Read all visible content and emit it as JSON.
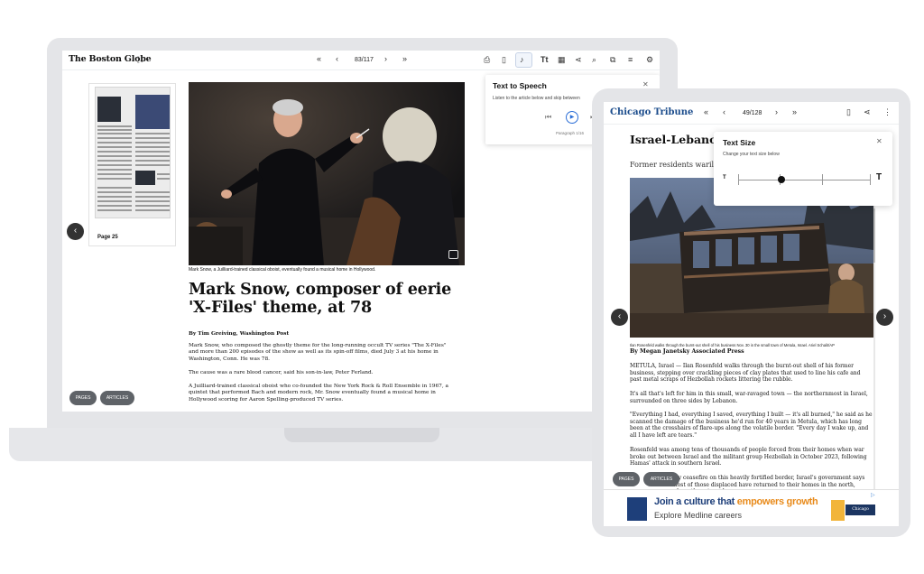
{
  "laptop": {
    "brand": "The Boston Globe",
    "page_indicator": "83/117",
    "thumbnail": {
      "label": "Page 25"
    },
    "photo_caption": "Mark Snow, a Juilliard-trained classical oboist, eventually found a musical home in Hollywood.",
    "headline": "Mark Snow, composer of eerie 'X-Files' theme, at 78",
    "byline": "By Tim Greiving, Washington Post",
    "paragraphs": [
      "Mark Snow, who composed the ghostly theme for the long-running occult TV series \"The X-Files\" and more than 200 episodes of the show as well as its spin-off films, died July 3 at his home in Washington, Conn. He was 78.",
      "The cause was a rare blood cancer, said his son-in-law, Peter Ferland.",
      "A Juilliard-trained classical oboist who co-founded the New York Rock & Roll Ensemble in 1967, a quintet that performed Bach and modern rock, Mr. Snow eventually found a musical home in Hollywood scoring for Aaron Spelling-produced TV series."
    ],
    "pills": {
      "pages": "PAGES",
      "articles": "ARTICLES"
    },
    "tts_panel": {
      "title": "Text to Speech",
      "description": "Listen to the article below and skip between",
      "paragraph_status": "Paragraph 1/16"
    }
  },
  "tablet": {
    "brand": "Chicago Tribune",
    "page_indicator": "49/128",
    "headline": "Israel-Lebanon c",
    "subhead": "Former residents warily d",
    "photo_caption": "Ilan Rosenfeld walks through the burnt-out shell of his business Nov. 30 in the small town of Metula, Israel. Ariel Schalit/AP",
    "byline": "By Megan Janetsky Associated Press",
    "paragraphs": [
      "METULA, Israel — Ilan Rosenfeld walks through the burnt-out shell of his former business, stepping over crackling pieces of clay plates that used to line his cafe and past metal scraps of Hezbollah rockets littering the rubble.",
      "It's all that's left for him in this small, war-ravaged town — the northernmost in Israel, surrounded on three sides by Lebanon.",
      "\"Everything I had, everything I saved, everything I built — it's all burned,\" he said as he scanned the damage of the business he'd run for 40 years in Metula, which has long been at the crosshairs of flare-ups along the volatile border. \"Every day I wake up, and all I have left are tears.\"",
      "Rosenfeld was among tens of thousands of people forced from their homes when war broke out between Israel and the militant group Hezbollah in October 2023, following Hamas' attack in southern Israel.",
      "sky ceasefire on this heavily fortified border, Israel's government says most of those displaced have returned to their homes in the north, where they struggle"
    ],
    "pills": {
      "pages": "PAGES",
      "articles": "ARTICLES"
    },
    "text_size_panel": {
      "title": "Text Size",
      "description": "Change your text size below",
      "small_label": "T",
      "large_label": "T",
      "level": 0.33
    },
    "ad": {
      "headline_part1": "Join a culture that ",
      "headline_highlight": "empowers growth",
      "subline": "Explore Medline careers",
      "badge_text": "Chicago Tribune",
      "ad_marker": "▷"
    }
  }
}
